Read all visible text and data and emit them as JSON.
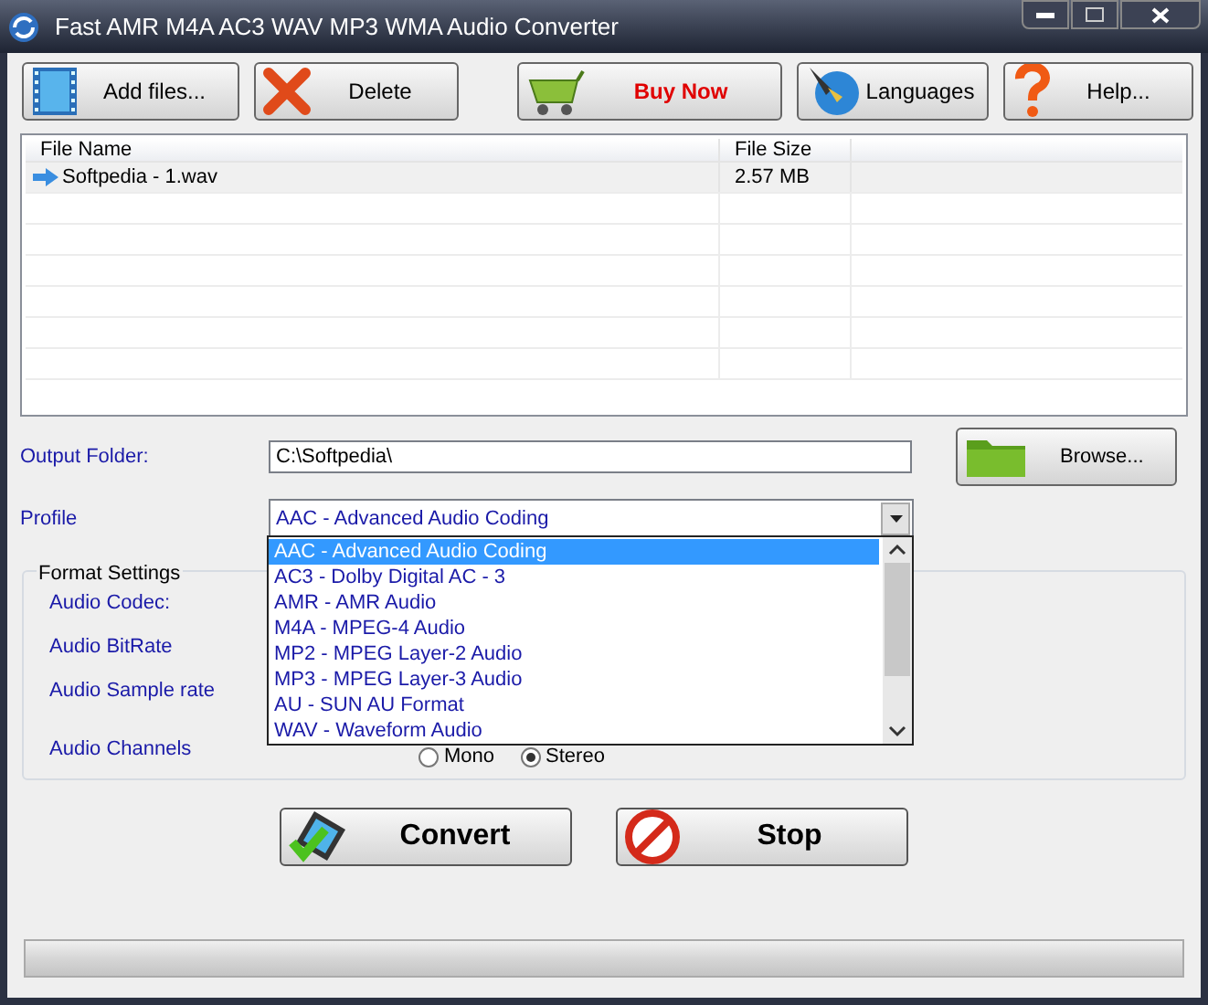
{
  "window": {
    "title": "Fast AMR M4A AC3 WAV MP3 WMA Audio Converter"
  },
  "toolbar": [
    {
      "label": "Add files...",
      "kind": "film"
    },
    {
      "label": "Delete",
      "kind": "delete"
    },
    {
      "label": "Buy Now",
      "kind": "cart"
    },
    {
      "label": "Languages",
      "kind": "pen"
    },
    {
      "label": "Help...",
      "kind": "help"
    }
  ],
  "file_list": {
    "columns": [
      "File Name",
      "File Size"
    ],
    "rows": [
      {
        "name": "Softpedia - 1.wav",
        "size": "2.57 MB"
      }
    ]
  },
  "output_folder": {
    "label": "Output Folder:",
    "value": "C:\\Softpedia\\",
    "button": "Browse..."
  },
  "profile": {
    "label": "Profile",
    "value": "AAC - Advanced Audio Coding",
    "expanded": true,
    "options": [
      {
        "label": "AAC - Advanced Audio Coding",
        "selected": true
      },
      {
        "label": "AC3 - Dolby Digital AC - 3",
        "selected": false
      },
      {
        "label": "AMR - AMR Audio",
        "selected": false
      },
      {
        "label": "M4A - MPEG-4 Audio",
        "selected": false
      },
      {
        "label": "MP2 - MPEG Layer-2 Audio",
        "selected": false
      },
      {
        "label": "MP3 - MPEG Layer-3 Audio",
        "selected": false
      },
      {
        "label": "AU - SUN AU Format",
        "selected": false
      },
      {
        "label": "WAV - Waveform Audio",
        "selected": false
      }
    ]
  },
  "format_settings": {
    "title": "Format Settings",
    "labels": [
      "Audio Codec:",
      "Audio BitRate",
      "Audio Sample rate",
      "Audio Channels"
    ],
    "channels": [
      {
        "label": "Mono",
        "selected": false
      },
      {
        "label": "Stereo",
        "selected": true
      }
    ]
  },
  "actions": [
    {
      "label": "Convert",
      "kind": "convert"
    },
    {
      "label": "Stop",
      "kind": "stop"
    }
  ],
  "progress": {
    "level": 0
  }
}
